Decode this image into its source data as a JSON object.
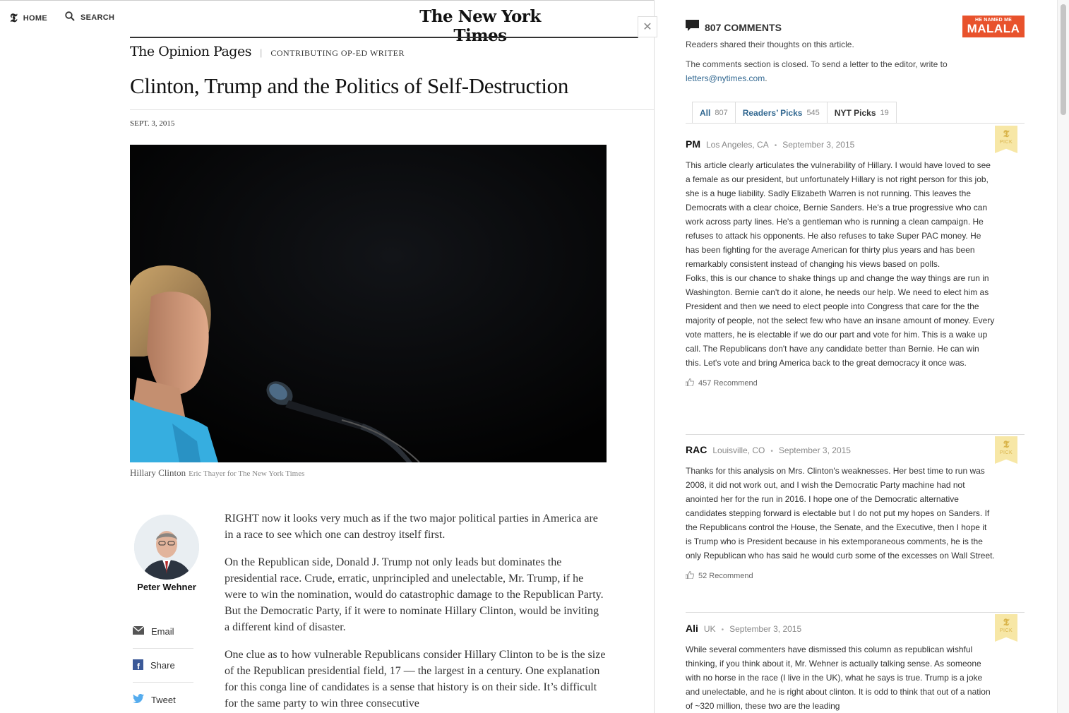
{
  "nav": {
    "home_label": "HOME",
    "search_label": "SEARCH",
    "logo_glyph": "𝕿",
    "masthead": "The New York Times"
  },
  "article": {
    "section": "The Opinion Pages",
    "kicker": "CONTRIBUTING OP-ED WRITER",
    "headline": "Clinton, Trump and the Politics of Self-Destruction",
    "date": "SEPT. 3, 2015",
    "caption": "Hillary Clinton",
    "credit": "Eric Thayer for The New York Times",
    "author": "Peter Wehner",
    "share": {
      "email": "Email",
      "share": "Share",
      "tweet": "Tweet"
    },
    "paragraphs": [
      "RIGHT now it looks very much as if the two major political parties in America are in a race to see which one can destroy itself first.",
      "On the Republican side, Donald J. Trump not only leads but dominates the presidential race. Crude, erratic, unprincipled and unelectable, Mr. Trump, if he were to win the nomination, would do catastrophic damage to the Republican Party. But the Democratic Party, if it were to nominate Hillary Clinton, would be inviting a different kind of disaster.",
      "One clue as to how vulnerable Republicans consider Hillary Clinton to be is the size of the Republican presidential field, 17 — the largest in a century. One explanation for this conga line of candidates is a sense that history is on their side. It’s difficult for the same party to win three consecutive"
    ]
  },
  "close_label": "✕",
  "comments": {
    "count_label": "807 COMMENTS",
    "promo_line1": "HE NAMED ME",
    "promo_line2": "MALALA",
    "subtitle": "Readers shared their thoughts on this article.",
    "closed_text": "The comments section is closed. To send a letter to the editor, write to ",
    "closed_email": "letters@nytimes.com",
    "closed_end": ".",
    "tabs": [
      {
        "label": "All",
        "count": "807"
      },
      {
        "label": "Readers’ Picks",
        "count": "545"
      },
      {
        "label": "NYT Picks",
        "count": "19"
      }
    ],
    "pick_label": "PICK",
    "pick_glyph": "𝕿",
    "items": [
      {
        "user": "PM",
        "location": "Los Angeles, CA",
        "date": "September 3, 2015",
        "paragraphs": [
          "This article clearly articulates the vulnerability of Hillary. I would have loved to see a female as our president, but unfortunately Hillary is not right person for this job, she is a huge liability. Sadly Elizabeth Warren is not running. This leaves the Democrats with a clear choice, Bernie Sanders. He's a true progressive who can work across party lines. He's a gentleman who is running a clean campaign. He refuses to attack his opponents. He also refuses to take Super PAC money. He has been fighting for the average American for thirty plus years and has been remarkably consistent instead of changing his views based on polls.",
          "Folks, this is our chance to shake things up and change the way things are run in Washington. Bernie can't do it alone, he needs our help. We need to elect him as President and then we need to elect people into Congress that care for the the majority of people, not the select few who have an insane amount of money. Every vote matters, he is electable if we do our part and vote for him. This is a wake up call. The Republicans don't have any candidate better than Bernie. He can win this. Let's vote and bring America back to the great democracy it once was."
        ],
        "recommend": "457 Recommend"
      },
      {
        "user": "RAC",
        "location": "Louisville, CO",
        "date": "September 3, 2015",
        "paragraphs": [
          "Thanks for this analysis on Mrs. Clinton's weaknesses. Her best time to run was 2008, it did not work out, and I wish the Democratic Party machine had not anointed her for the run in 2016. I hope one of the Democratic alternative candidates stepping forward is electable but I do not put my hopes on Sanders. If the Republicans control the House, the Senate, and the Executive, then I hope it is Trump who is President because in his extemporaneous comments, he is the only Republican who has said he would curb some of the excesses on Wall Street."
        ],
        "recommend": "52 Recommend"
      },
      {
        "user": "Ali",
        "location": "UK",
        "date": "September 3, 2015",
        "paragraphs": [
          "While several commenters have dismissed this column as republican wishful thinking, if you think about it, Mr. Wehner is actually talking sense. As someone with no horse in the race (I live in the UK), what he says is true. Trump is a joke and unelectable, and he is right about clinton. It is odd to think that out of a nation of ~320 million, these two are the leading"
        ],
        "recommend": ""
      }
    ]
  }
}
